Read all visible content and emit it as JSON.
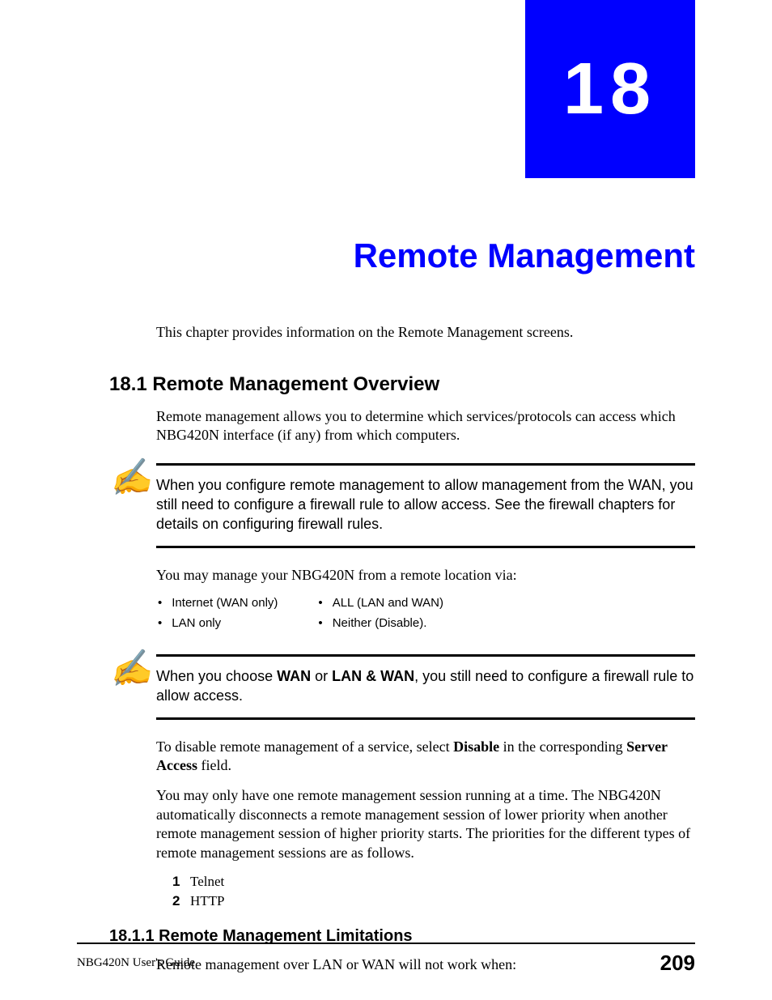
{
  "chapter": {
    "number": "18",
    "title": "Remote Management"
  },
  "intro": "This chapter provides information on the Remote Management screens.",
  "section1": {
    "heading": "18.1  Remote Management Overview",
    "p1": "Remote management allows you to determine which services/protocols can access which NBG420N interface (if any) from which computers.",
    "note1": "When you configure remote management to allow management from the WAN, you still need to configure a firewall rule to allow access. See the firewall chapters for details on configuring firewall rules.",
    "p2": "You may manage your NBG420N from a remote location via:",
    "options": {
      "col1": [
        "Internet (WAN only)",
        "LAN only"
      ],
      "col2": [
        "ALL (LAN and WAN)",
        "Neither (Disable)."
      ]
    },
    "note2_pre": "When you choose ",
    "note2_b1": "WAN",
    "note2_mid": " or ",
    "note2_b2": "LAN & WAN",
    "note2_post": ", you still need to configure a firewall rule to allow access.",
    "p3_pre": "To disable remote management of a service, select ",
    "p3_b1": "Disable",
    "p3_mid": " in the corresponding ",
    "p3_b2": "Server Access",
    "p3_post": " field.",
    "p4": "You may only have one remote management session running at a time. The NBG420N automatically disconnects a remote management session of lower priority when another remote management session of higher priority starts. The priorities for the different types of remote management sessions are as follows.",
    "priorities": [
      {
        "n": "1",
        "label": "Telnet"
      },
      {
        "n": "2",
        "label": "HTTP"
      }
    ]
  },
  "section1_1": {
    "heading": "18.1.1  Remote Management Limitations",
    "p1": "Remote management over LAN or WAN will not work when:"
  },
  "footer": {
    "guide": "NBG420N User's Guide",
    "page": "209"
  },
  "icons": {
    "note": "✍"
  }
}
